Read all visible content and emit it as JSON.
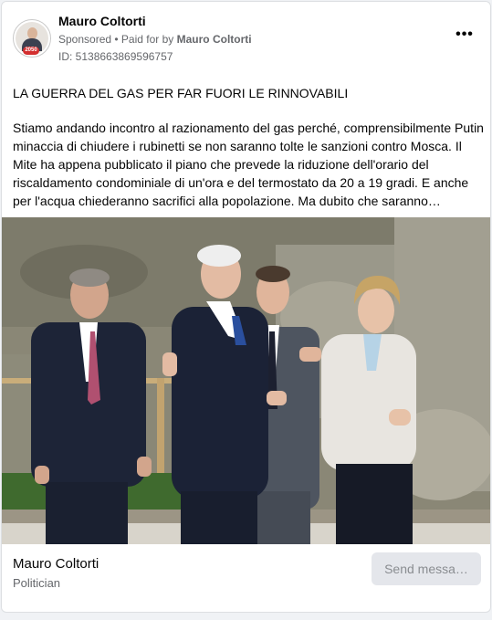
{
  "post": {
    "author": "Mauro Coltorti",
    "sponsored_label": "Sponsored",
    "separator": " • ",
    "paid_prefix": "Paid for by ",
    "paid_by": "Mauro Coltorti",
    "ad_id": "ID: 5138663869596757",
    "avatar_badge": "2050",
    "more_icon": "more-horizontal-icon",
    "more_glyph": "•••",
    "headline": "LA GUERRA DEL GAS PER FAR FUORI LE RINNOVABILI",
    "body": "Stiamo andando incontro al razionamento del gas perché, comprensibilmente Putin minaccia di chiudere i rubinetti se non saranno tolte le sanzioni contro Mosca. Il Mite ha appena pubblicato il piano che prevede la riduzione dell'orario del riscaldamento condominiale di un'ora e del termostato da 20 a 19 gradi. E anche per l'acqua chiederanno sacrifici alla popolazione. Ma dubito che saranno…"
  },
  "footer": {
    "page_name": "Mauro Coltorti",
    "page_category": "Politician",
    "send_button": "Send messa…"
  },
  "colors": {
    "text_primary": "#050505",
    "text_secondary": "#65676b",
    "button_bg": "#e4e6eb",
    "button_text": "#8a8d91",
    "badge_red": "#d32f2f"
  }
}
